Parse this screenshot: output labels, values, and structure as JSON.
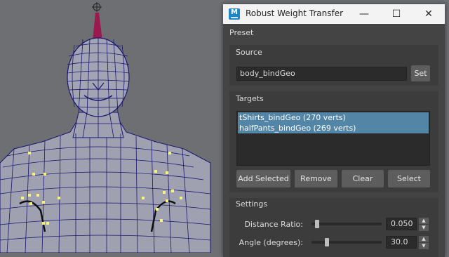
{
  "viewport": {
    "description_icon": "rotate-manipulator-icon"
  },
  "dialog": {
    "title": "Robust Weight Transfer",
    "app_icon": "M",
    "minimize_glyph": "—",
    "maximize_glyph": "☐",
    "close_glyph": "✕"
  },
  "menu": {
    "preset": "Preset"
  },
  "source": {
    "label": "Source",
    "value": "body_bindGeo",
    "set_button": "Set"
  },
  "targets": {
    "label": "Targets",
    "items": [
      "tShirts_bindGeo (270 verts)",
      "halfPants_bindGeo (269 verts)"
    ],
    "buttons": {
      "add_selected": "Add Selected",
      "remove": "Remove",
      "clear": "Clear",
      "select": "Select"
    }
  },
  "settings": {
    "label": "Settings",
    "distance_ratio": {
      "label": "Distance Ratio:",
      "value": "0.050",
      "slider_fraction": 0.05
    },
    "angle": {
      "label": "Angle (degrees):",
      "value": "30.0",
      "slider_fraction": 0.2
    }
  }
}
